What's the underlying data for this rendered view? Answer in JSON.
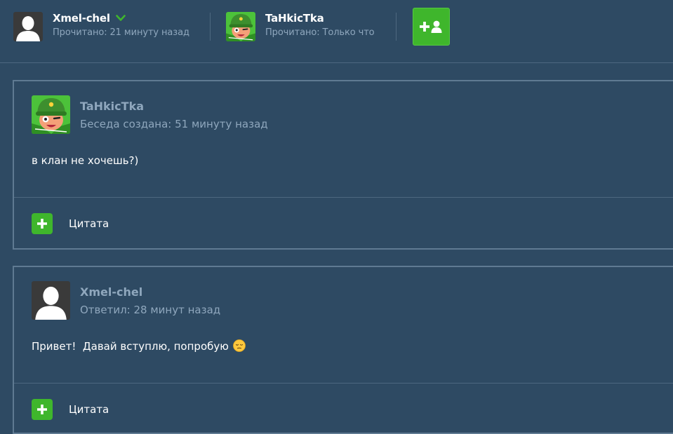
{
  "participants": [
    {
      "name": "Xmel-chel",
      "status": "Прочитано: 21 минуту назад",
      "avatar": "default-silhouette",
      "verified": true
    },
    {
      "name": "TaHkicTka",
      "status": "Прочитано: Только что",
      "avatar": "tank-character"
    }
  ],
  "add_participant": {
    "icon": "plus-user-icon"
  },
  "messages": [
    {
      "author": "TaHkicTka",
      "meta": "Беседа создана: 51 минуту назад",
      "text": "в клан не хочешь?)",
      "quote_label": "Цитата",
      "avatar": "tank-character"
    },
    {
      "author": "Xmel-chel",
      "meta": "Ответил: 28 минут назад",
      "text": "Привет!  Давай вступлю, попробую",
      "emoji": "pensive-face",
      "quote_label": "Цитата",
      "avatar": "default-silhouette"
    }
  ],
  "colors": {
    "background": "#2e4a63",
    "accent": "#3fb62c",
    "muted": "#8fa7bd",
    "border": "#5f7a92"
  }
}
